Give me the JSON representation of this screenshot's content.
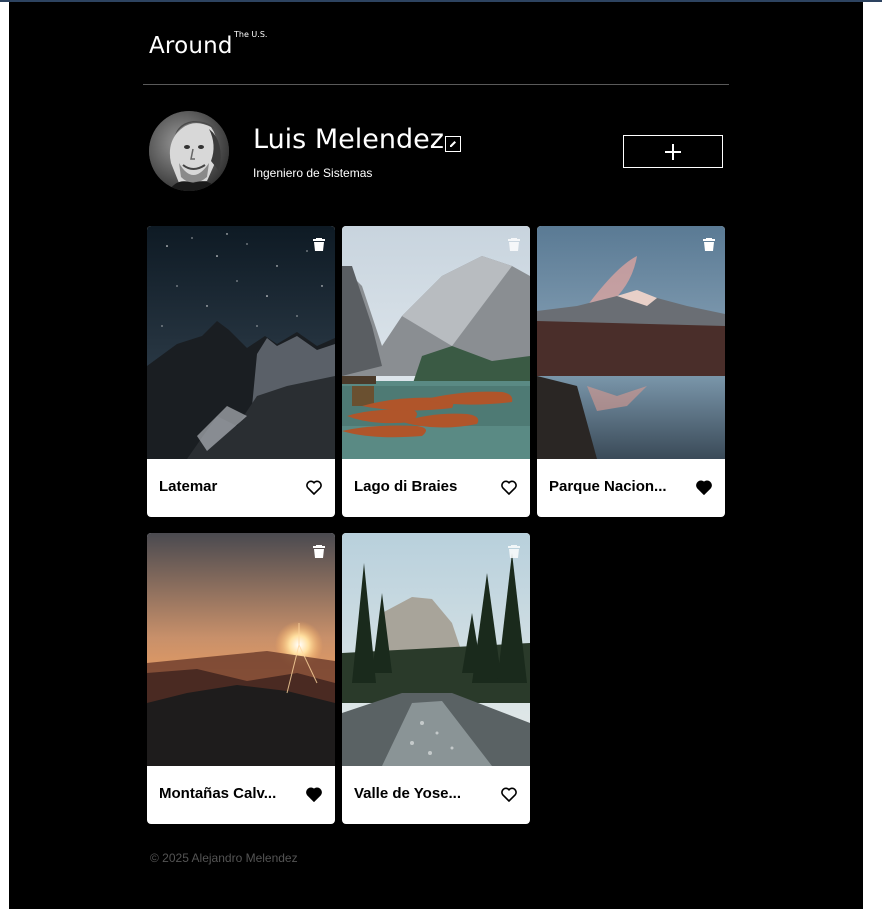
{
  "header": {
    "logo": "Around",
    "logo_sup": "The U.S."
  },
  "profile": {
    "name": "Luis Melendez",
    "job": "Ingeniero de Sistemas"
  },
  "cards": [
    {
      "title": "Latemar",
      "liked": false
    },
    {
      "title": "Lago di Braies",
      "liked": false
    },
    {
      "title": "Parque Nacion...",
      "liked": true
    },
    {
      "title": "Montañas Calv...",
      "liked": true
    },
    {
      "title": "Valle de Yose...",
      "liked": false
    }
  ],
  "icons": {
    "edit": "pencil-icon",
    "add": "plus-icon",
    "delete": "trash-icon",
    "like": "heart-icon"
  },
  "footer": {
    "copyright": "© 2025 Alejandro Melendez"
  }
}
